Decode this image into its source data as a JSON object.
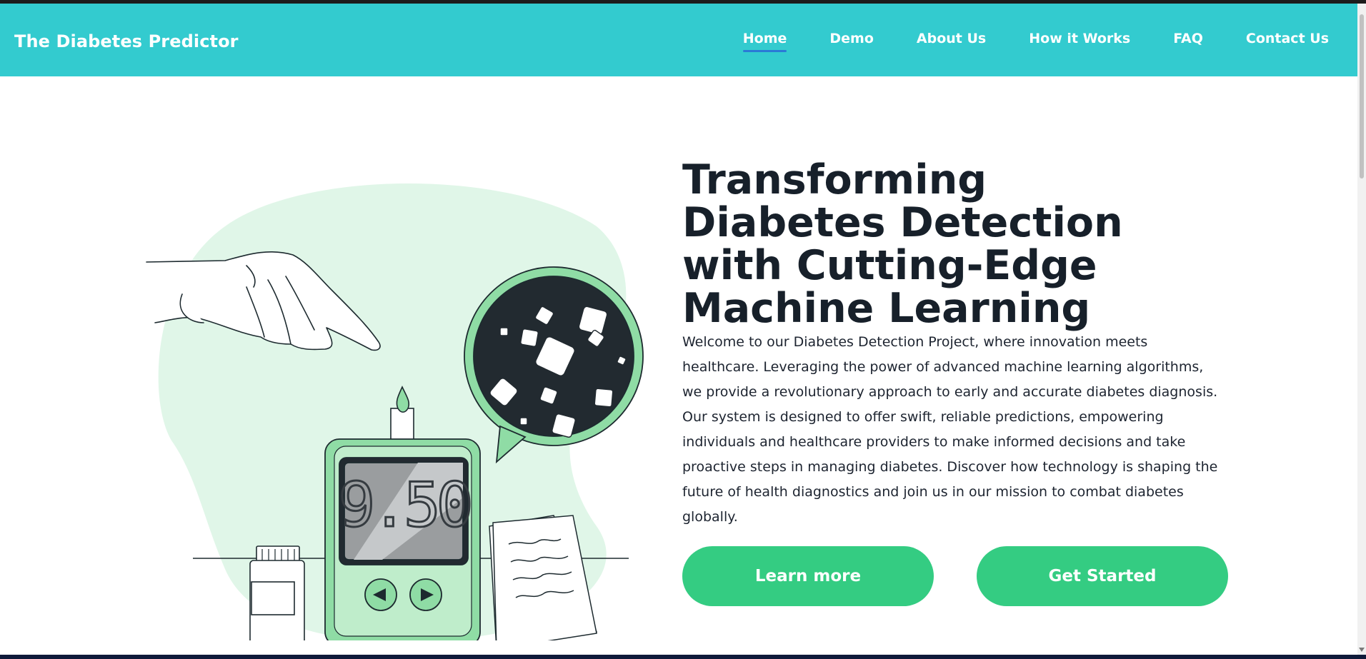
{
  "brand": {
    "title": "The Diabetes Predictor"
  },
  "nav": {
    "items": [
      {
        "label": "Home",
        "active": true
      },
      {
        "label": "Demo",
        "active": false
      },
      {
        "label": "About Us",
        "active": false
      },
      {
        "label": "How it Works",
        "active": false
      },
      {
        "label": "FAQ",
        "active": false
      },
      {
        "label": "Contact Us",
        "active": false
      }
    ]
  },
  "hero": {
    "title": "Transforming Diabetes Detection with Cutting-Edge Machine Learning",
    "description": "Welcome to our Diabetes Detection Project, where innovation meets healthcare. Leveraging the power of advanced machine learning algorithms, we provide a revolutionary approach to early and accurate diabetes diagnosis. Our system is designed to offer swift, reliable predictions, empowering individuals and healthcare providers to make informed decisions and take proactive steps in managing diabetes. Discover how technology is shaping the future of health diagnostics and join us in our mission to combat diabetes globally.",
    "learn_more_label": "Learn more",
    "get_started_label": "Get Started"
  },
  "illustration": {
    "meter_reading": "9.50",
    "icon": "glucose-meter-illustration"
  },
  "colors": {
    "navbar": "#33cbcf",
    "button": "#34cc82",
    "accent_green": "#8fdca5",
    "blob": "#e0f6e8",
    "active_underline": "#2a7ad6"
  }
}
